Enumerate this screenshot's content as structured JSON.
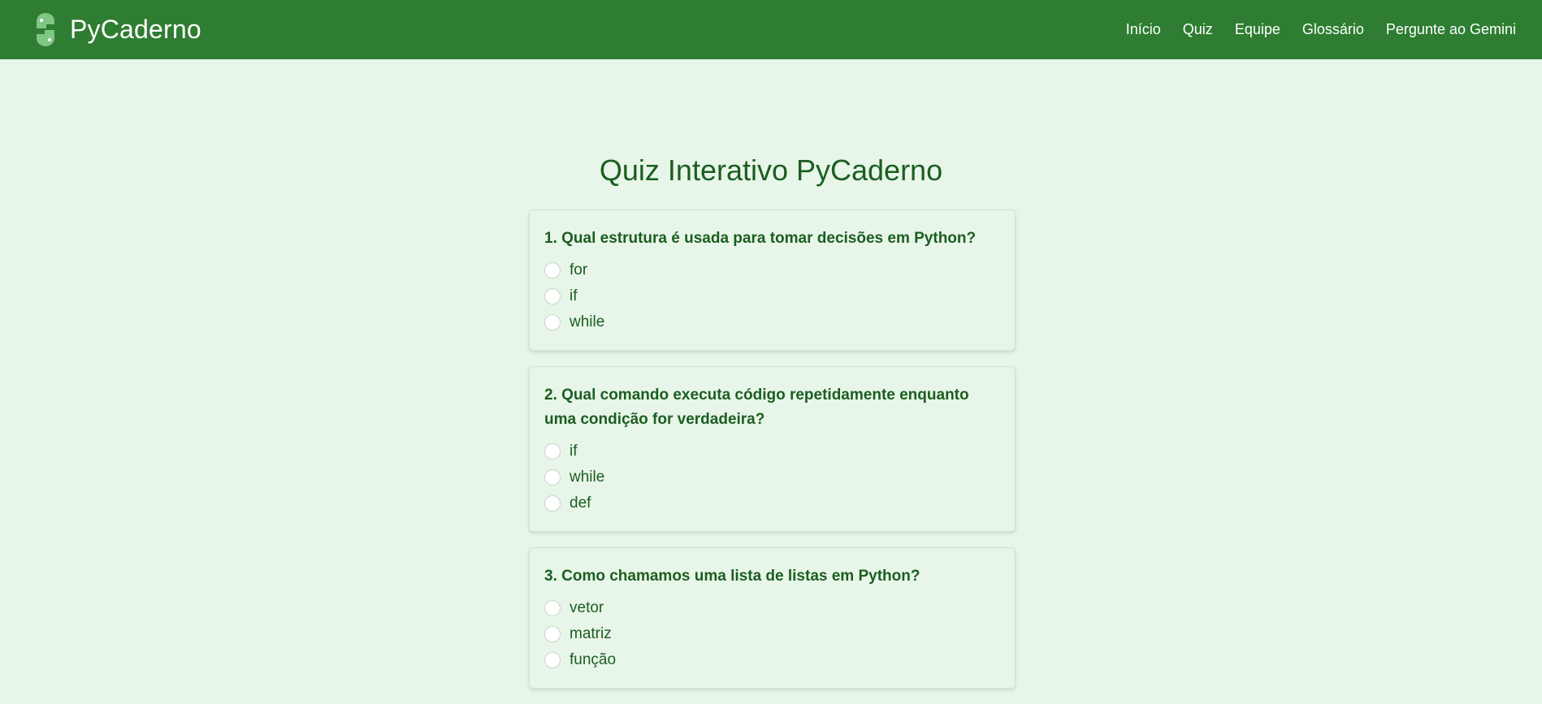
{
  "brand": {
    "name": "PyCaderno",
    "logo_icon": "python-logo-icon"
  },
  "nav": {
    "items": [
      {
        "label": "Início"
      },
      {
        "label": "Quiz"
      },
      {
        "label": "Equipe"
      },
      {
        "label": "Glossário"
      },
      {
        "label": "Pergunte ao Gemini"
      }
    ]
  },
  "page": {
    "title": "Quiz Interativo PyCaderno"
  },
  "questions": [
    {
      "text": "1. Qual estrutura é usada para tomar decisões em Python?",
      "options": [
        "for",
        "if",
        "while"
      ]
    },
    {
      "text": "2. Qual comando executa código repetidamente enquanto uma condição for verdadeira?",
      "options": [
        "if",
        "while",
        "def"
      ]
    },
    {
      "text": "3. Como chamamos uma lista de listas em Python?",
      "options": [
        "vetor",
        "matriz",
        "função"
      ]
    }
  ],
  "colors": {
    "header": "#2e7d32",
    "background": "#e8f5e9",
    "text": "#1b5e20",
    "logo": "#81c784"
  }
}
